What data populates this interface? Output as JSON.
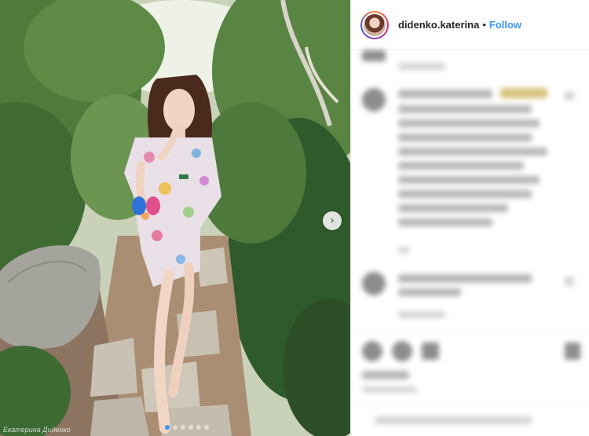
{
  "post": {
    "username": "didenko.katerina",
    "separator": "•",
    "follow_label": "Follow"
  },
  "photo": {
    "watermark": "Екатерина Диденко",
    "carousel_total": 6,
    "carousel_active_index": 0,
    "next_icon": "chevron-right-icon"
  },
  "colors": {
    "accent": "#3897f0",
    "text": "#262626"
  }
}
